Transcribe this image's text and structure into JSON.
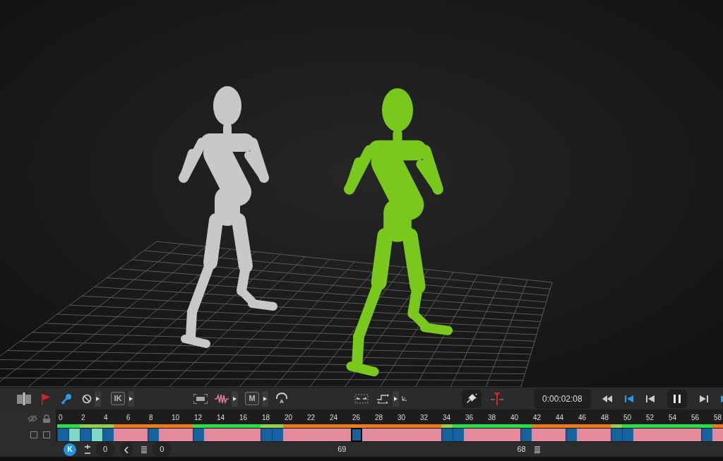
{
  "toolbar": {
    "ik_label": "IK",
    "m_label": "M",
    "audio_label": "A",
    "timecode": "0:00:02:08"
  },
  "timeline": {
    "track_toggles": [
      {
        "checked": false
      },
      {
        "checked": false
      }
    ],
    "cells": [
      {
        "tick": "0",
        "kind": "key",
        "color": "#28e04a",
        "selected": false
      },
      {
        "kind": "blend",
        "color": "#28e04a",
        "selected": false
      },
      {
        "tick": "2",
        "kind": "key",
        "color": "#8fd24a",
        "selected": false
      },
      {
        "kind": "blend",
        "color": "#8fd24a",
        "selected": false
      },
      {
        "tick": "4",
        "kind": "key",
        "color": "#8fd24a",
        "selected": false
      },
      {
        "kind": "gap",
        "color": "#f07c18",
        "selected": false
      },
      {
        "tick": "6",
        "kind": "gap",
        "color": "#f07c18",
        "selected": false
      },
      {
        "kind": "gap",
        "color": "#f07c18",
        "selected": false
      },
      {
        "tick": "8",
        "kind": "key",
        "color": "#f07c18",
        "selected": false
      },
      {
        "kind": "gap",
        "color": "#f07c18",
        "selected": false
      },
      {
        "tick": "10",
        "kind": "gap",
        "color": "#f07c18",
        "selected": false
      },
      {
        "kind": "gap",
        "color": "#f07c18",
        "selected": false
      },
      {
        "tick": "12",
        "kind": "key",
        "color": "#28e04a",
        "selected": false
      },
      {
        "kind": "gap",
        "color": "#28e04a",
        "selected": false
      },
      {
        "tick": "14",
        "kind": "gap",
        "color": "#28e04a",
        "selected": false
      },
      {
        "kind": "gap",
        "color": "#28e04a",
        "selected": false
      },
      {
        "tick": "16",
        "kind": "gap",
        "color": "#28e04a",
        "selected": false
      },
      {
        "kind": "gap",
        "color": "#28e04a",
        "selected": false
      },
      {
        "tick": "18",
        "kind": "key",
        "color": "#8fd24a",
        "selected": false
      },
      {
        "kind": "key",
        "color": "#8fd24a",
        "selected": false
      },
      {
        "tick": "20",
        "kind": "gap",
        "color": "#f07c18",
        "selected": false
      },
      {
        "kind": "gap",
        "color": "#f07c18",
        "selected": false
      },
      {
        "tick": "22",
        "kind": "gap",
        "color": "#f07c18",
        "selected": false
      },
      {
        "kind": "gap",
        "color": "#f07c18",
        "selected": false
      },
      {
        "tick": "24",
        "kind": "gap",
        "color": "#f07c18",
        "selected": false
      },
      {
        "kind": "gap",
        "color": "#f07c18",
        "selected": false
      },
      {
        "tick": "26",
        "kind": "key",
        "color": "#f07c18",
        "selected": true
      },
      {
        "kind": "gap",
        "color": "#f07c18",
        "selected": false
      },
      {
        "tick": "28",
        "kind": "gap",
        "color": "#f07c18",
        "selected": false
      },
      {
        "kind": "gap",
        "color": "#f07c18",
        "selected": false
      },
      {
        "tick": "30",
        "kind": "gap",
        "color": "#f07c18",
        "selected": false
      },
      {
        "kind": "gap",
        "color": "#f07c18",
        "selected": false
      },
      {
        "tick": "32",
        "kind": "gap",
        "color": "#f07c18",
        "selected": false
      },
      {
        "kind": "gap",
        "color": "#f07c18",
        "selected": false
      },
      {
        "tick": "34",
        "kind": "key",
        "color": "#8fd24a",
        "selected": false
      },
      {
        "kind": "key",
        "color": "#28e04a",
        "selected": false
      },
      {
        "tick": "36",
        "kind": "gap",
        "color": "#28e04a",
        "selected": false
      },
      {
        "kind": "gap",
        "color": "#28e04a",
        "selected": false
      },
      {
        "tick": "38",
        "kind": "gap",
        "color": "#28e04a",
        "selected": false
      },
      {
        "kind": "gap",
        "color": "#28e04a",
        "selected": false
      },
      {
        "tick": "40",
        "kind": "gap",
        "color": "#28e04a",
        "selected": false
      },
      {
        "kind": "key",
        "color": "#28e04a",
        "selected": false
      },
      {
        "tick": "42",
        "kind": "gap",
        "color": "#f07c18",
        "selected": false
      },
      {
        "kind": "gap",
        "color": "#f07c18",
        "selected": false
      },
      {
        "tick": "44",
        "kind": "gap",
        "color": "#f07c18",
        "selected": false
      },
      {
        "kind": "key",
        "color": "#f07c18",
        "selected": false
      },
      {
        "tick": "46",
        "kind": "gap",
        "color": "#f07c18",
        "selected": false
      },
      {
        "kind": "gap",
        "color": "#f07c18",
        "selected": false
      },
      {
        "tick": "48",
        "kind": "gap",
        "color": "#f07c18",
        "selected": false
      },
      {
        "kind": "key",
        "color": "#8fd24a",
        "selected": false
      },
      {
        "tick": "50",
        "kind": "key",
        "color": "#28e04a",
        "selected": false
      },
      {
        "kind": "gap",
        "color": "#28e04a",
        "selected": false
      },
      {
        "tick": "52",
        "kind": "gap",
        "color": "#28e04a",
        "selected": false
      },
      {
        "kind": "gap",
        "color": "#28e04a",
        "selected": false
      },
      {
        "tick": "54",
        "kind": "gap",
        "color": "#28e04a",
        "selected": false
      },
      {
        "kind": "gap",
        "color": "#28e04a",
        "selected": false
      },
      {
        "tick": "56",
        "kind": "gap",
        "color": "#28e04a",
        "selected": false
      },
      {
        "kind": "key",
        "color": "#28e04a",
        "selected": false
      },
      {
        "tick": "58",
        "kind": "gap",
        "color": "#f07c18",
        "selected": false
      }
    ]
  },
  "footer": {
    "key_label": "K",
    "start_field": "0",
    "step_field": "0",
    "range_start": "69",
    "range_end": "68"
  }
}
